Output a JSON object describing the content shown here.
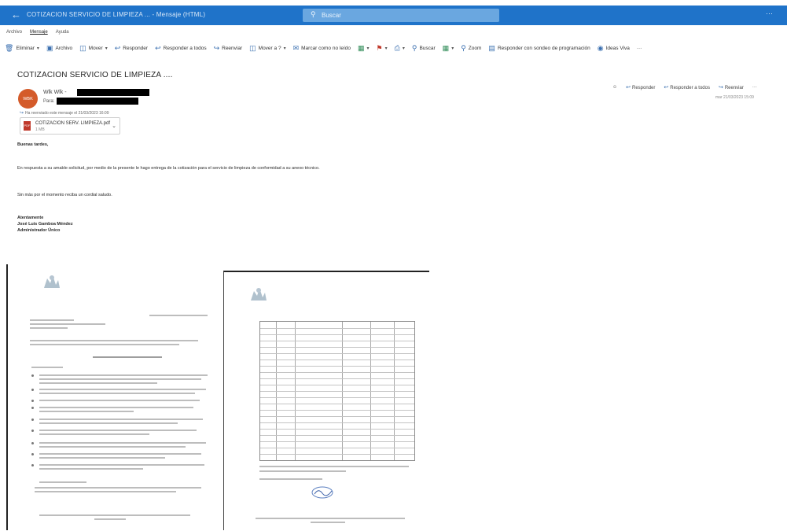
{
  "window": {
    "title": "COTIZACION SERVICIO DE LIMPIEZA ... - Mensaje (HTML)",
    "search_placeholder": "Buscar"
  },
  "ribbon": {
    "tabs": [
      "Archivo",
      "Mensaje",
      "Ayuda"
    ],
    "active_tab": "Mensaje"
  },
  "toolbar": {
    "items": [
      {
        "label": "Eliminar",
        "icon": "trash-icon"
      },
      {
        "label": "Archivo",
        "icon": "archive-icon"
      },
      {
        "label": "Mover",
        "icon": "move-icon"
      },
      {
        "label": "Responder",
        "icon": "reply-icon"
      },
      {
        "label": "Responder a todos",
        "icon": "reply-all-icon"
      },
      {
        "label": "Reenviar",
        "icon": "forward-icon"
      },
      {
        "label": "Mover a ?",
        "icon": "quick-step-icon"
      },
      {
        "label": "Marcar como no leído",
        "icon": "mark-unread-icon"
      },
      {
        "label": "",
        "icon": "categorize-icon"
      },
      {
        "label": "",
        "icon": "flag-icon"
      },
      {
        "label": "",
        "icon": "print-icon"
      },
      {
        "label": "Buscar",
        "icon": "find-icon"
      },
      {
        "label": "",
        "icon": "translate-icon"
      },
      {
        "label": "Zoom",
        "icon": "zoom-icon"
      },
      {
        "label": "Responder con sondeo de programación",
        "icon": "schedule-reply-icon"
      },
      {
        "label": "Ideas Viva",
        "icon": "viva-icon"
      }
    ],
    "more": "···"
  },
  "email": {
    "subject": "COTIZACION SERVICIO DE LIMPIEZA ....",
    "avatar_initials": "WBK",
    "sender_prefix": "Wlk Wlk -",
    "to_label": "Para:",
    "forwarded_note": "Ha reenviado este mensaje el 21/03/2023 16:09",
    "attachment": {
      "name": "COTIZACION SERV. LIMPIEZA.pdf",
      "size": "1 MB"
    },
    "actions": [
      "Responder",
      "Responder a todos",
      "Reenviar"
    ],
    "action_more": "···",
    "date": "mar 21/03/2023 15:09",
    "body": {
      "greeting": "Buenas tardes,",
      "paragraph1": "En respuesta a su amable solicitud, por medio de la presente le hago entrega de la cotización para el servicio de limpieza de conformidad a su anexo técnico.",
      "paragraph2": "Sin más por el momento reciba un cordial saludo.",
      "signature": [
        "Atentamente",
        "José Luis Gamboa Méndez",
        "Administrador Único"
      ]
    }
  },
  "scans": {
    "page1_label": "scanned-quotation-page-1",
    "page2_label": "scanned-quotation-page-2"
  },
  "colors": {
    "titlebar": "#1f73c9",
    "avatar": "#d45b2a",
    "accent": "#3a6fb0"
  }
}
